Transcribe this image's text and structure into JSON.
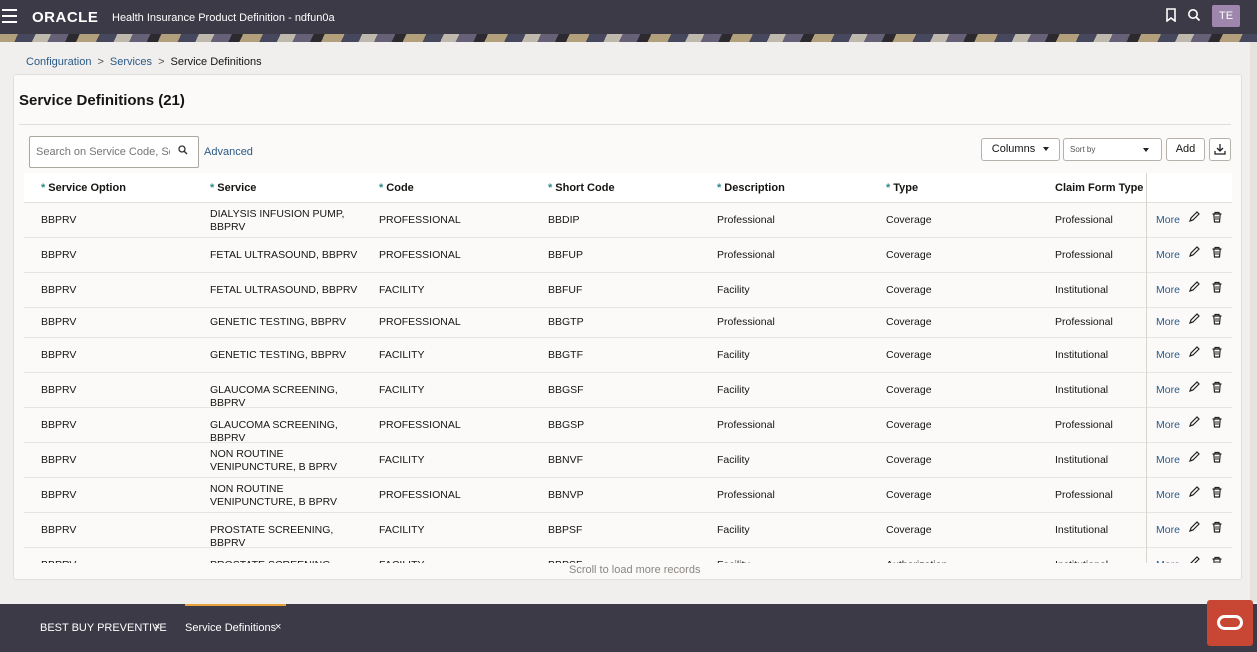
{
  "header": {
    "logo": "ORACLE",
    "app_title": "Health Insurance Product Definition - ndfun0a",
    "bookmark_icon": "bookmark-icon",
    "search_icon": "search-icon",
    "avatar": "TE"
  },
  "breadcrumb": {
    "items": [
      "Configuration",
      "Services"
    ],
    "current": "Service Definitions",
    "separator": ">"
  },
  "page": {
    "title": "Service Definitions (21)"
  },
  "toolbar": {
    "search_placeholder": "Search on Service Code, Serv",
    "advanced_label": "Advanced",
    "columns_label": "Columns",
    "sortby_placeholder": "Sort by",
    "add_label": "Add",
    "download_icon": "download-icon"
  },
  "table": {
    "columns": [
      {
        "label": "Service Option",
        "required": true
      },
      {
        "label": "Service",
        "required": true
      },
      {
        "label": "Code",
        "required": true
      },
      {
        "label": "Short Code",
        "required": true
      },
      {
        "label": "Description",
        "required": true
      },
      {
        "label": "Type",
        "required": true
      },
      {
        "label": "Claim Form Type",
        "required": false
      }
    ],
    "required_marker": "*",
    "more_label": "More",
    "rows": [
      [
        "BBPRV",
        "DIALYSIS INFUSION PUMP, BBPRV",
        "PROFESSIONAL",
        "BBDIP",
        "Professional",
        "Coverage",
        "Professional"
      ],
      [
        "BBPRV",
        "FETAL ULTRASOUND, BBPRV",
        "PROFESSIONAL",
        "BBFUP",
        "Professional",
        "Coverage",
        "Professional"
      ],
      [
        "BBPRV",
        "FETAL ULTRASOUND, BBPRV",
        "FACILITY",
        "BBFUF",
        "Facility",
        "Coverage",
        "Institutional"
      ],
      [
        "BBPRV",
        "GENETIC TESTING, BBPRV",
        "PROFESSIONAL",
        "BBGTP",
        "Professional",
        "Coverage",
        "Professional"
      ],
      [
        "BBPRV",
        "GENETIC TESTING, BBPRV",
        "FACILITY",
        "BBGTF",
        "Facility",
        "Coverage",
        "Institutional"
      ],
      [
        "BBPRV",
        "GLAUCOMA SCREENING, BBPRV",
        "FACILITY",
        "BBGSF",
        "Facility",
        "Coverage",
        "Institutional"
      ],
      [
        "BBPRV",
        "GLAUCOMA SCREENING, BBPRV",
        "PROFESSIONAL",
        "BBGSP",
        "Professional",
        "Coverage",
        "Professional"
      ],
      [
        "BBPRV",
        "NON ROUTINE VENIPUNCTURE, B BPRV",
        "FACILITY",
        "BBNVF",
        "Facility",
        "Coverage",
        "Institutional"
      ],
      [
        "BBPRV",
        "NON ROUTINE VENIPUNCTURE, B BPRV",
        "PROFESSIONAL",
        "BBNVP",
        "Professional",
        "Coverage",
        "Professional"
      ],
      [
        "BBPRV",
        "PROSTATE SCREENING, BBPRV",
        "FACILITY",
        "BBPSF",
        "Facility",
        "Coverage",
        "Institutional"
      ],
      [
        "BBPRV",
        "PROSTATE SCREENING, BBPRV",
        "FACILITY",
        "BBPSF",
        "Facility",
        "Authorization",
        "Institutional"
      ]
    ],
    "scroll_message": "Scroll to load more records"
  },
  "footer": {
    "tabs": [
      {
        "label": "BEST BUY PREVENTIVE",
        "active": false
      },
      {
        "label": "Service Definitions",
        "active": true
      }
    ],
    "close_glyph": "×"
  },
  "colors": {
    "header_bg": "#3c3a46",
    "link": "#2a5a86",
    "required": "#2a8a86",
    "active_tab": "#e8a33a",
    "oracle_red": "#c74634"
  }
}
